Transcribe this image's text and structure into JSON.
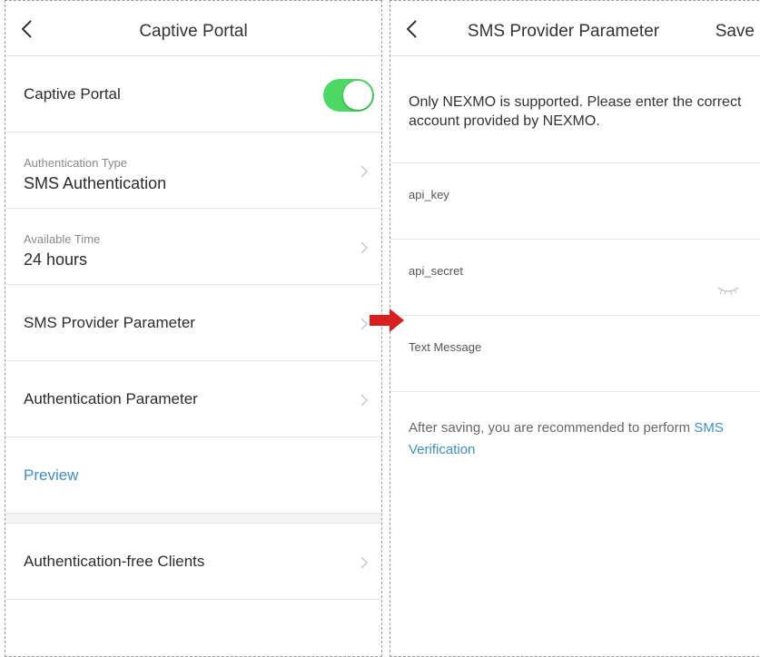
{
  "left": {
    "title": "Captive Portal",
    "rows": {
      "captive_portal": {
        "label": "Captive Portal",
        "toggle_on": true
      },
      "auth_type": {
        "label": "Authentication Type",
        "value": "SMS Authentication"
      },
      "available_time": {
        "label": "Available Time",
        "value": "24 hours"
      },
      "sms_provider": {
        "label": "SMS Provider Parameter"
      },
      "auth_param": {
        "label": "Authentication Parameter"
      },
      "preview": {
        "label": "Preview"
      },
      "free_clients": {
        "label": "Authentication-free Clients"
      }
    }
  },
  "right": {
    "title": "SMS Provider Parameter",
    "save_label": "Save",
    "notice": "Only NEXMO is supported. Please enter the correct account provided by NEXMO.",
    "fields": {
      "api_key": {
        "label": "api_key",
        "value": ""
      },
      "api_secret": {
        "label": "api_secret",
        "value": ""
      },
      "text_message": {
        "label": "Text Message",
        "value": ""
      }
    },
    "after_text": "After saving, you are recommended to perform ",
    "after_link": "SMS Verification"
  },
  "colors": {
    "toggle_on": "#4cd964",
    "link": "#3d8ec9",
    "arrow": "#d81e1e"
  },
  "icons": [
    "chevron-left-icon",
    "chevron-right-icon",
    "eye-closed-icon",
    "red-arrow-right-icon"
  ]
}
